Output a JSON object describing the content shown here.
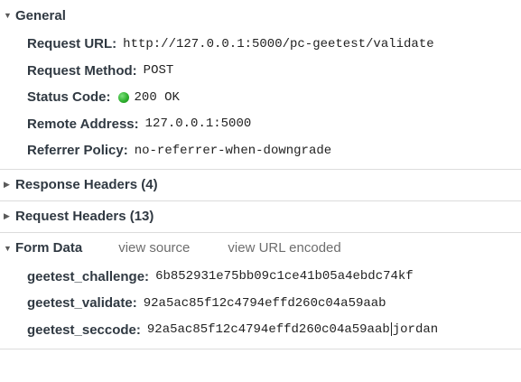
{
  "general": {
    "title": "General",
    "rows": [
      {
        "key": "Request URL:",
        "value": "http://127.0.0.1:5000/pc-geetest/validate"
      },
      {
        "key": "Request Method:",
        "value": "POST"
      },
      {
        "key": "Status Code:",
        "value": "200 OK",
        "status_color": "#2fb02f"
      },
      {
        "key": "Remote Address:",
        "value": "127.0.0.1:5000"
      },
      {
        "key": "Referrer Policy:",
        "value": "no-referrer-when-downgrade"
      }
    ]
  },
  "response_headers": {
    "title": "Response Headers (4)"
  },
  "request_headers": {
    "title": "Request Headers (13)"
  },
  "form_data": {
    "title": "Form Data",
    "view_source_label": "view source",
    "view_url_encoded_label": "view URL encoded",
    "rows": [
      {
        "key": "geetest_challenge:",
        "value": "6b852931e75bb09c1ce41b05a4ebdc74kf"
      },
      {
        "key": "geetest_validate:",
        "value": "92a5ac85f12c4794effd260c04a59aab"
      },
      {
        "key": "geetest_seccode:",
        "value_before_cursor": "92a5ac85f12c4794effd260c04a59aab",
        "value_after_cursor": "jordan"
      }
    ]
  },
  "icons": {
    "expanded": "triangle-down-icon",
    "collapsed": "triangle-right-icon"
  },
  "colors": {
    "text": "#303942",
    "link": "#6d6d6d",
    "divider": "#dcdcdc",
    "status_ok": "#2fb02f"
  }
}
